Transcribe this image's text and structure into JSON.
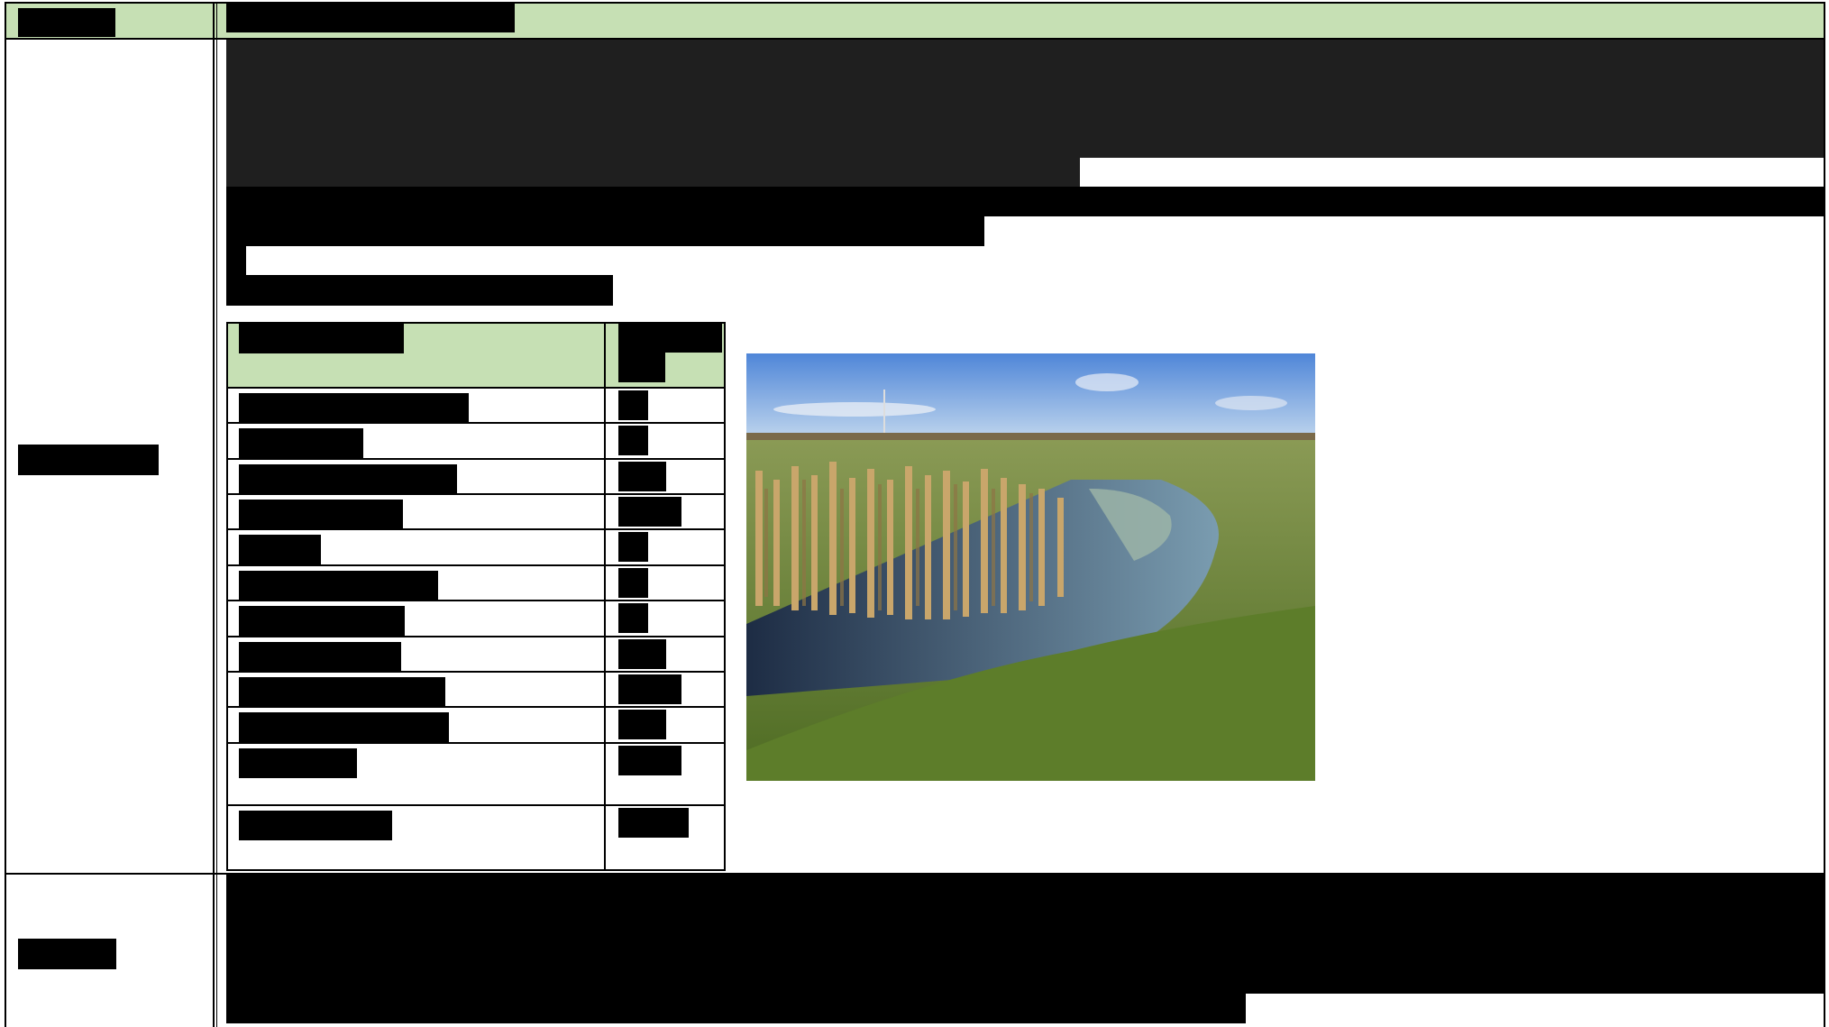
{
  "header": {
    "left_label": "",
    "right_label": ""
  },
  "section1": {
    "row_label": "",
    "intro_paragraph": "",
    "bold_paragraph": "",
    "sub_label": "",
    "table": {
      "header_cols": [
        "",
        ""
      ],
      "rows": [
        {
          "label": "",
          "value": ""
        },
        {
          "label": "",
          "value": ""
        },
        {
          "label": "",
          "value": ""
        },
        {
          "label": "",
          "value": ""
        },
        {
          "label": "",
          "value": ""
        },
        {
          "label": "",
          "value": ""
        },
        {
          "label": "",
          "value": ""
        },
        {
          "label": "",
          "value": ""
        },
        {
          "label": "",
          "value": ""
        },
        {
          "label": "",
          "value": ""
        },
        {
          "label": "",
          "value": ""
        },
        {
          "label": "",
          "value": ""
        }
      ]
    },
    "photo": {
      "alt": "",
      "sky_color": "#6f9ad6",
      "grass_color": "#6d8f3b",
      "reed_color": "#c9a66b",
      "water_color": "#2b3f5a"
    }
  },
  "section2": {
    "row_label": "",
    "paragraph": ""
  },
  "colors": {
    "header_green": "#c6e0b4",
    "redaction": "#000000",
    "border": "#000000"
  }
}
